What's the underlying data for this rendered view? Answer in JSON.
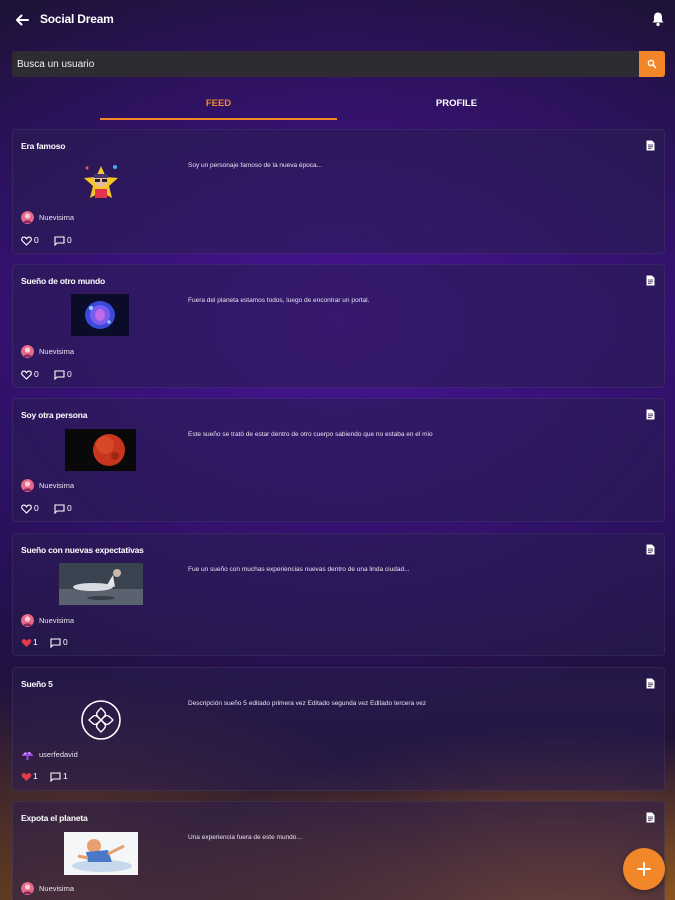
{
  "appbar": {
    "title": "Social Dream"
  },
  "search": {
    "placeholder": "Busca un usuario"
  },
  "tabs": [
    {
      "label": "FEED"
    },
    {
      "label": "PROFILE"
    }
  ],
  "active_tab": "FEED",
  "posts": [
    {
      "title": "Era famoso",
      "description": "Soy un personaje famoso de la nueva época...",
      "author": "Nuevisima",
      "likes": "0",
      "comments": "0",
      "liked": false,
      "image": "famous-star-character-image"
    },
    {
      "title": "Sueño de otro mundo",
      "description": "Fuera del planeta estamos todos, luego de encontrar un portal.",
      "author": "Nuevisima",
      "likes": "0",
      "comments": "0",
      "liked": false,
      "image": "blue-portal-image"
    },
    {
      "title": "Soy otra persona",
      "description": "Este sueño se trató de estar dentro de otro cuerpo sabiendo que no estaba en el mio",
      "author": "Nuevisima",
      "likes": "0",
      "comments": "0",
      "liked": false,
      "image": "red-planet-image"
    },
    {
      "title": "Sueño con nuevas expectativas",
      "description": "Fue un sueño con muchas experiencias nuevas dentro de una linda ciudad...",
      "author": "Nuevisima",
      "likes": "1",
      "comments": "0",
      "liked": true,
      "image": "floating-people-image"
    },
    {
      "title": "Sueño 5",
      "description": "Descripción sueño 5 editado primera vez Editado segunda vez Editado tercera vez",
      "author": "userfedavid",
      "likes": "1",
      "comments": "1",
      "liked": true,
      "image": "circular-logo-image"
    },
    {
      "title": "Expota el planeta",
      "description": "Una experiencia fuera de este mundo...",
      "author": "Nuevisima",
      "likes": "",
      "comments": "",
      "liked": false,
      "image": "cartoon-flying-character-image"
    }
  ],
  "colors": {
    "accent": "#f2872a",
    "like_active": "#e23b4e",
    "background": "#2a1060"
  }
}
